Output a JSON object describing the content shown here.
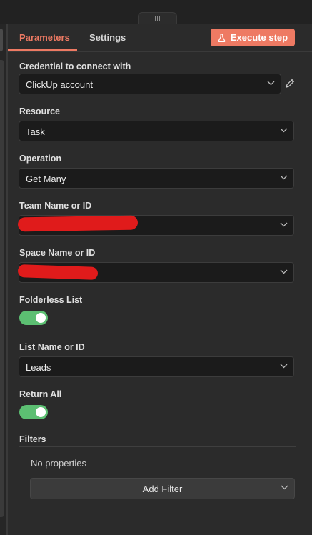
{
  "tabs": [
    {
      "label": "Parameters",
      "active": true
    },
    {
      "label": "Settings",
      "active": false
    }
  ],
  "execute_button": {
    "label": "Execute step",
    "icon": "flask-icon"
  },
  "fields": {
    "credential": {
      "label": "Credential to connect with",
      "value": "ClickUp account"
    },
    "resource": {
      "label": "Resource",
      "value": "Task"
    },
    "operation": {
      "label": "Operation",
      "value": "Get Many"
    },
    "team": {
      "label": "Team Name or ID",
      "value": ""
    },
    "space": {
      "label": "Space Name or ID",
      "value": ""
    },
    "folderless": {
      "label": "Folderless List",
      "enabled": true
    },
    "list": {
      "label": "List Name or ID",
      "value": "Leads"
    },
    "return_all": {
      "label": "Return All",
      "enabled": true
    }
  },
  "filters": {
    "label": "Filters",
    "empty_text": "No properties",
    "add_label": "Add Filter"
  },
  "colors": {
    "accent": "#ee7a63",
    "toggle_on": "#5cbf72",
    "redaction": "#e01b1b"
  }
}
